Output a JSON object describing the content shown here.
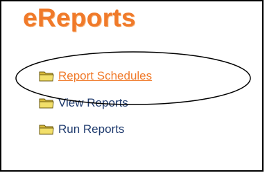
{
  "app": {
    "title": "eReports"
  },
  "menu": {
    "items": [
      {
        "label": "Report Schedules",
        "icon": "folder-icon",
        "active": true
      },
      {
        "label": "View Reports",
        "icon": "folder-icon",
        "active": false
      },
      {
        "label": "Run Reports",
        "icon": "folder-icon",
        "active": false
      }
    ]
  },
  "colors": {
    "brand": "#f07a2a",
    "link": "#1f3b6e",
    "active_link": "#f07a2a",
    "folder_fill": "#e8cf4a",
    "folder_shadow": "#a08a20"
  }
}
